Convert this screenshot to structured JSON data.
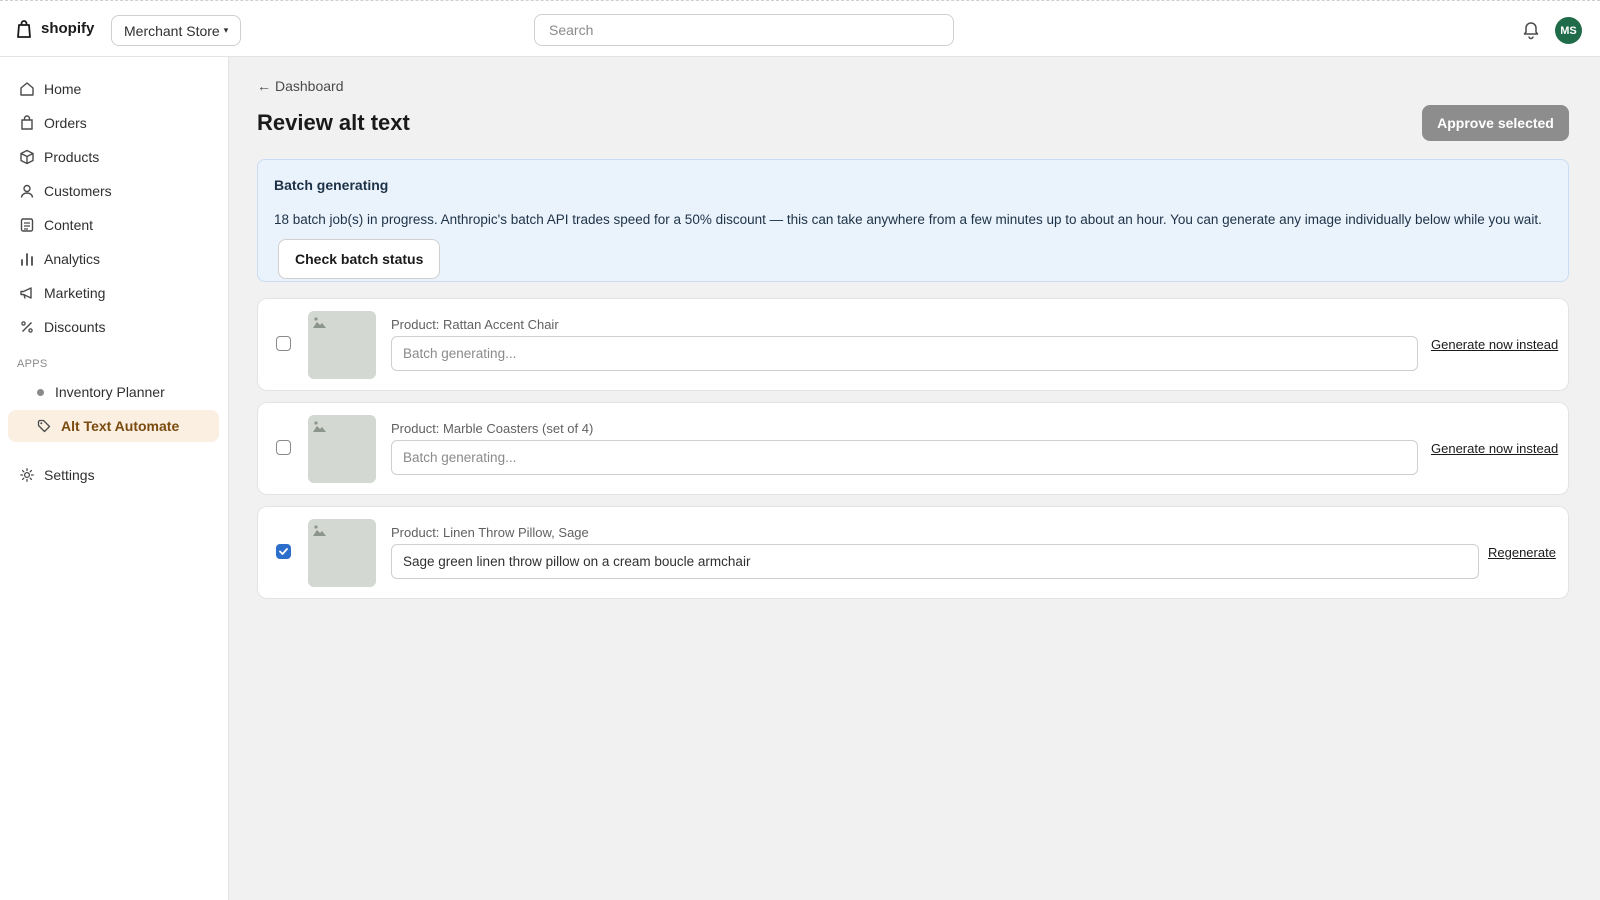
{
  "topbar": {
    "brand": "shopify",
    "store_name": "Merchant Store",
    "search_placeholder": "Search",
    "avatar_initials": "MS"
  },
  "sidebar": {
    "items": [
      {
        "label": "Home",
        "icon": "home-icon"
      },
      {
        "label": "Orders",
        "icon": "orders-icon"
      },
      {
        "label": "Products",
        "icon": "products-icon"
      },
      {
        "label": "Customers",
        "icon": "customers-icon"
      },
      {
        "label": "Content",
        "icon": "content-icon"
      },
      {
        "label": "Analytics",
        "icon": "analytics-icon"
      },
      {
        "label": "Marketing",
        "icon": "marketing-icon"
      },
      {
        "label": "Discounts",
        "icon": "discounts-icon"
      }
    ],
    "apps_label": "APPS",
    "apps": [
      {
        "label": "Inventory Planner"
      },
      {
        "label": "Alt Text Automate",
        "active": true
      }
    ],
    "settings_label": "Settings"
  },
  "main": {
    "back_label": "Dashboard",
    "title": "Review alt text",
    "approve_label": "Approve selected"
  },
  "banner": {
    "title": "Batch generating",
    "text": "18 batch job(s) in progress. Anthropic's batch API trades speed for a 50% discount — this can take anywhere from a few minutes up to about an hour. You can generate any image individually below while you wait.",
    "button_label": "Check batch status"
  },
  "rows": [
    {
      "label": "Product: Rattan Accent Chair",
      "value": "",
      "placeholder": "Batch generating...",
      "action": "Generate now instead",
      "checked": false
    },
    {
      "label": "Product: Marble Coasters (set of 4)",
      "value": "",
      "placeholder": "Batch generating...",
      "action": "Generate now instead",
      "checked": false
    },
    {
      "label": "Product: Linen Throw Pillow, Sage",
      "value": "Sage green linen throw pillow on a cream boucle armchair",
      "placeholder": "",
      "action": "Regenerate",
      "checked": true
    }
  ],
  "colors": {
    "accent_blue": "#2c6ecb",
    "active_app_bg": "#fbefe1",
    "avatar_bg": "#1f6b4a",
    "banner_bg": "#eaf2fc"
  }
}
